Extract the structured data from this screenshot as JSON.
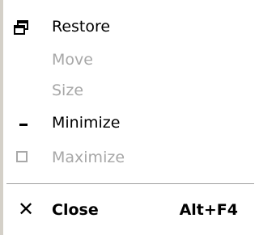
{
  "menu": {
    "items": [
      {
        "label": "Restore",
        "icon": "restore-icon",
        "enabled": true,
        "shortcut": ""
      },
      {
        "label": "Move",
        "icon": "",
        "enabled": false,
        "shortcut": ""
      },
      {
        "label": "Size",
        "icon": "",
        "enabled": false,
        "shortcut": ""
      },
      {
        "label": "Minimize",
        "icon": "minimize-icon",
        "enabled": true,
        "shortcut": ""
      },
      {
        "label": "Maximize",
        "icon": "maximize-icon",
        "enabled": false,
        "shortcut": ""
      },
      {
        "label": "Close",
        "icon": "close-icon",
        "enabled": true,
        "shortcut": "Alt+F4"
      }
    ],
    "close_glyph": "✕"
  },
  "colors": {
    "disabled_text": "#a7a7a7",
    "separator": "#9f9f9f"
  }
}
